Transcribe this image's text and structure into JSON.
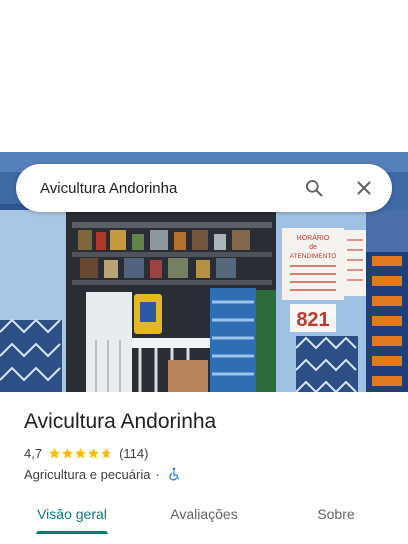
{
  "search": {
    "query": "Avicultura Andorinha",
    "search_icon": "search-icon",
    "close_icon": "close-icon"
  },
  "photo": {
    "sign_text": "HORÁRIO de ATENDIMENTO",
    "street_number": "821"
  },
  "place": {
    "name": "Avicultura Andorinha",
    "rating": "4,7",
    "stars": 4.7,
    "review_count": "(114)",
    "category": "Agricultura e pecuária",
    "separator": "·",
    "accessibility_icon": "wheelchair-icon"
  },
  "tabs": [
    {
      "label": "Visão geral",
      "active": true
    },
    {
      "label": "Avaliações",
      "active": false
    },
    {
      "label": "Sobre",
      "active": false
    }
  ],
  "colors": {
    "accent": "#0b7a75",
    "star": "#fbbc04",
    "accessibility": "#1a73e8"
  }
}
